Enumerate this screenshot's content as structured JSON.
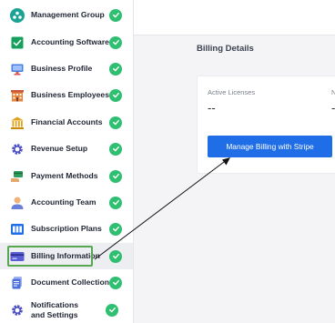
{
  "sidebar": {
    "items": [
      {
        "label": "Management Group",
        "icon": "group-icon"
      },
      {
        "label": "Accounting Software",
        "icon": "checkbox-icon"
      },
      {
        "label": "Business Profile",
        "icon": "monitor-icon"
      },
      {
        "label": "Business Employees",
        "icon": "building-icon"
      },
      {
        "label": "Financial Accounts",
        "icon": "bank-icon"
      },
      {
        "label": "Revenue Setup",
        "icon": "gear-icon"
      },
      {
        "label": "Payment Methods",
        "icon": "card-hand-icon"
      },
      {
        "label": "Accounting Team",
        "icon": "person-icon"
      },
      {
        "label": "Subscription Plans",
        "icon": "plans-icon"
      },
      {
        "label": "Billing Information",
        "icon": "billing-card-icon"
      },
      {
        "label": "Document Collection",
        "icon": "documents-icon"
      },
      {
        "label": "Notifications and Settings",
        "icon": "gear-icon"
      }
    ],
    "active_index": 9
  },
  "main": {
    "section_title": "Billing Details",
    "card": {
      "active_licenses_label": "Active Licenses",
      "active_licenses_value": "--",
      "second_label": "N",
      "second_value": "-",
      "manage_button": "Manage Billing with Stripe"
    }
  },
  "colors": {
    "check": "#2fbf71",
    "button": "#1f6ee8",
    "highlight": "#56a74f",
    "arrow": "#111111"
  }
}
